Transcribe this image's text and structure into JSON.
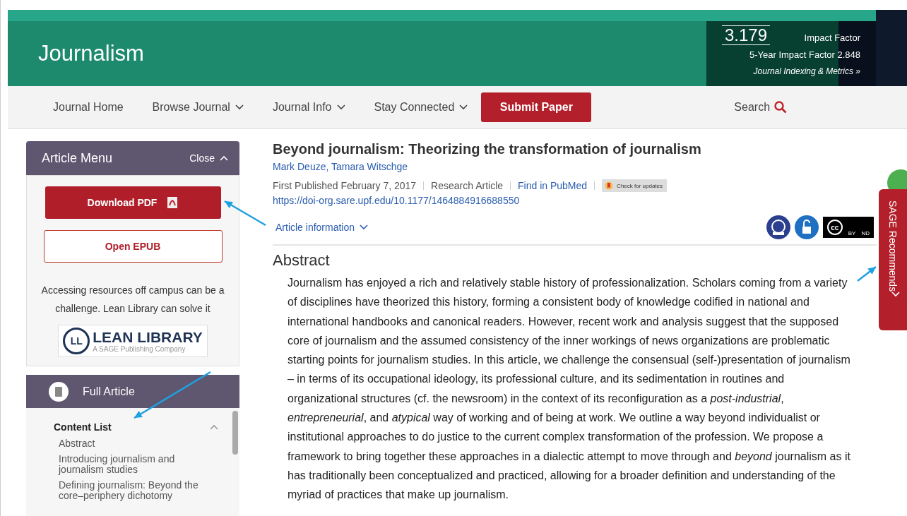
{
  "journal": {
    "title": "Journalism",
    "impact_factor": "3.179",
    "impact_factor_label": "Impact Factor",
    "five_year": "5-Year Impact Factor 2.848",
    "metrics_link": "Journal Indexing & Metrics »"
  },
  "nav": {
    "items": [
      {
        "label": "Journal Home",
        "has_menu": false
      },
      {
        "label": "Browse Journal",
        "has_menu": true
      },
      {
        "label": "Journal Info",
        "has_menu": true
      },
      {
        "label": "Stay Connected",
        "has_menu": true
      }
    ],
    "submit": "Submit Paper",
    "search": "Search"
  },
  "article_menu": {
    "title": "Article Menu",
    "close": "Close",
    "download": "Download PDF",
    "epub": "Open EPUB",
    "promo": "Accessing resources off campus can be a challenge. Lean Library can solve it",
    "logo": {
      "mark": "LL",
      "name": "LEAN LIBRARY",
      "tagline": "A SAGE Publishing Company"
    }
  },
  "full_article": {
    "label": "Full Article",
    "content_list": {
      "title": "Content List",
      "expanded": true,
      "items": [
        "Abstract",
        "Introducing journalism and journalism studies",
        "Defining journalism: Beyond the core–periphery dichotomy"
      ]
    }
  },
  "article": {
    "title": "Beyond journalism: Theorizing the transformation of journalism",
    "authors": "Mark Deuze, Tamara Witschge",
    "published": "First Published February 7, 2017",
    "type": "Research Article",
    "pubmed": "Find in PubMed",
    "updates": "Check for updates",
    "doi": "https://doi-org.sare.upf.edu/10.1177/1464884916688550",
    "info": "Article information",
    "license": {
      "mark": "cc",
      "terms": [
        "BY",
        "ND"
      ]
    },
    "abstract": {
      "heading": "Abstract",
      "text": "Journalism has enjoyed a rich and relatively stable history of professionalization. Scholars coming from a variety of disciplines have theorized this history, forming a consistent body of knowledge codified in national and international handbooks and canonical readers. However, recent work and analysis suggest that the supposed core of journalism and the assumed consistency of the inner workings of news organizations are problematic starting points for journalism studies. In this article, we challenge the consensual (self-)presentation of journalism – in terms of its occupational ideology, its professional culture, and its sedimentation in routines and organizational structures (cf. the newsroom) in the context of its reconfiguration as a *post-industrial*, *entrepreneurial*, and *atypical* way of working and of being at work. We outline a way beyond individualist or institutional approaches to do justice to the current complex transformation of the profession. We propose a framework to bring together these approaches in a dialectic attempt to move through and *beyond* journalism as it has traditionally been conceptualized and practiced, allowing for a broader definition and understanding of the myriad of practices that make up journalism."
    }
  },
  "side_tab": {
    "label": "SAGE Recommends"
  }
}
